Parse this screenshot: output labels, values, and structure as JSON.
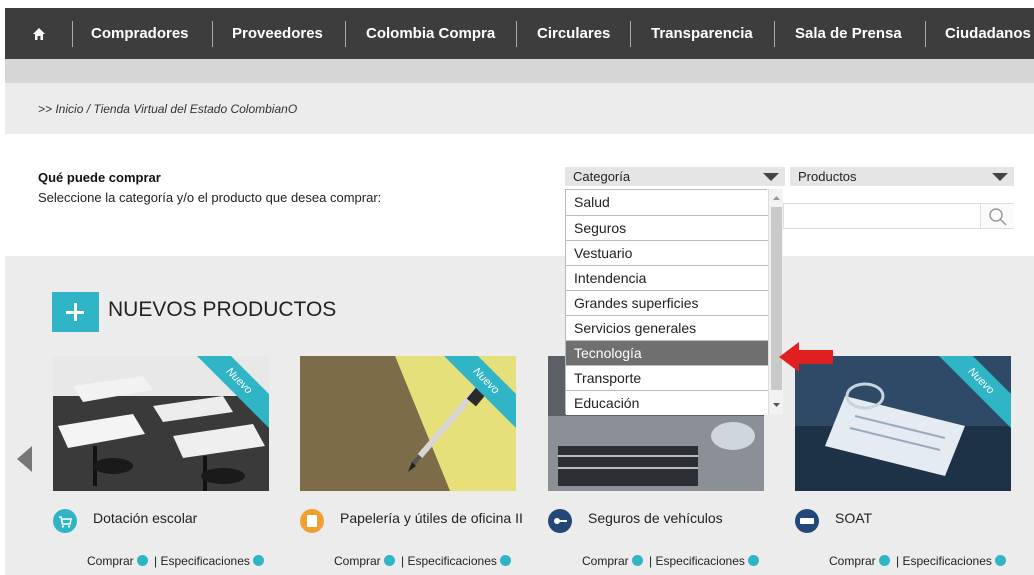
{
  "nav": {
    "home_icon": "home-icon",
    "items": [
      "Compradores",
      "Proveedores",
      "Colombia Compra",
      "Circulares",
      "Transparencia",
      "Sala de Prensa",
      "Ciudadanos"
    ]
  },
  "breadcrumb": ">> Inicio / Tienda Virtual del Estado ColombianO",
  "que_puede": {
    "title": "Qué puede comprar",
    "subtitle": "Seleccione la categoría y/o el producto que desea comprar:"
  },
  "selects": {
    "categoria": "Categoría",
    "productos": "Productos"
  },
  "dropdown": {
    "options": [
      "Salud",
      "Seguros",
      "Vestuario",
      "Intendencia",
      "Grandes superficies",
      "Servicios generales",
      "Tecnología",
      "Transporte",
      "Educación"
    ],
    "highlighted": "Tecnología"
  },
  "nuevos": {
    "title": "NUEVOS PRODUCTOS",
    "badge": "Nuevo",
    "products": [
      {
        "name": "Dotación escolar",
        "icon": "cart-icon",
        "icon_color": "#2fb5c5"
      },
      {
        "name": "Papelería y útiles de oficina II",
        "icon": "notebook-icon",
        "icon_color": "#f0a030"
      },
      {
        "name": "Seguros de vehículos",
        "icon": "car-key-icon",
        "icon_color": "#24477a"
      },
      {
        "name": "SOAT",
        "icon": "soat-icon",
        "icon_color": "#24477a"
      }
    ],
    "comprar": "Comprar",
    "especificaciones": "| Especificaciones"
  },
  "colors": {
    "accent": "#2fb5c5",
    "nav_bg": "#3d3d3d",
    "arrow": "#e02020"
  }
}
